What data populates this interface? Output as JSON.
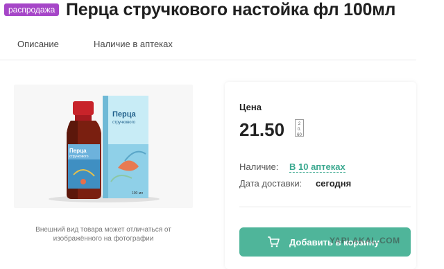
{
  "header": {
    "sale_badge": "распродажа",
    "title": "Перца стручкового настойка фл 100мл"
  },
  "tabs": [
    {
      "label": "Описание"
    },
    {
      "label": "Наличие в аптеках"
    }
  ],
  "product": {
    "caption": "Внешний вид товара может отличаться от изображённого на фотографии",
    "bottle_label_line1": "Перца",
    "bottle_label_line2": "стручкового",
    "box_label_line1": "Перца",
    "box_label_line2": "стручкового",
    "volume": "100 мл"
  },
  "price_card": {
    "price_label": "Цена",
    "price": "21.50",
    "price_small": "20.60",
    "availability_label": "Наличие:",
    "availability_value": "В 10 аптеках",
    "delivery_label": "Дата доставки:",
    "delivery_value": "сегодня",
    "cart_button": "Добавить в корзину"
  },
  "watermark": "YAPLAKAL.COM",
  "colors": {
    "sale_badge": "#a646c8",
    "accent_green": "#4fb59a",
    "link_green": "#3aa88f"
  }
}
